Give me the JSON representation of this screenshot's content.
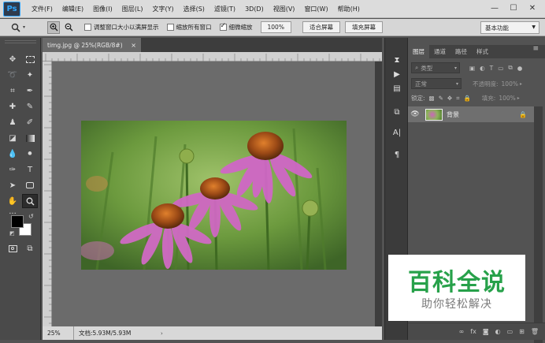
{
  "app": {
    "logo": "Ps"
  },
  "menubar": {
    "items": [
      "文件(F)",
      "编辑(E)",
      "图像(I)",
      "图层(L)",
      "文字(Y)",
      "选择(S)",
      "滤镜(T)",
      "3D(D)",
      "视图(V)",
      "窗口(W)",
      "帮助(H)"
    ],
    "window_controls": [
      "—",
      "☐",
      "✕"
    ]
  },
  "optionsbar": {
    "tool_icon": "magnifier-icon",
    "fit_window_label": "调整窗口大小以满屏显示",
    "zoom_all_label": "缩放所有窗口",
    "scrubby_label": "细微缩放",
    "scrubby_checked": true,
    "zoom_value": "100%",
    "fit_screen_label": "适合屏幕",
    "fill_screen_label": "填充屏幕",
    "workspace": "基本功能"
  },
  "document": {
    "tab_title": "timg.jpg @ 25%(RGB/8#)",
    "tab_close": "×",
    "status_zoom": "25%",
    "status_info": "文档:5.93M/5.93M",
    "status_arrow": "›"
  },
  "toolbar": {
    "tools": [
      "move-tool",
      "marquee-tool",
      "lasso-tool",
      "magic-wand-tool",
      "crop-tool",
      "eyedropper-tool",
      "healing-tool",
      "brush-tool",
      "stamp-tool",
      "history-brush-tool",
      "eraser-tool",
      "gradient-tool",
      "blur-tool",
      "dodge-tool",
      "pen-tool",
      "type-tool",
      "path-select-tool",
      "shape-tool",
      "hand-tool",
      "zoom-tool"
    ],
    "more": "···",
    "foreground_color": "#000000",
    "background_color": "#ffffff"
  },
  "layers_panel": {
    "tabs": [
      "图层",
      "通道",
      "路径",
      "样式"
    ],
    "active_tab": "图层",
    "kind_filter": "类型",
    "blend_mode": "正常",
    "opacity_label": "不透明度:",
    "opacity_value": "100%",
    "lock_label": "锁定:",
    "fill_label": "填充:",
    "fill_value": "100%",
    "layers": [
      {
        "name": "背景",
        "visible": true,
        "locked": true
      }
    ],
    "footer_icons": [
      "link-icon",
      "fx-icon",
      "mask-icon",
      "adjustment-icon",
      "folder-icon",
      "new-layer-icon",
      "trash-icon"
    ],
    "footer_labels": [
      "∞",
      "fx",
      "◙",
      "◐",
      "▭",
      "⊞",
      "🗑"
    ]
  },
  "watermark": {
    "main": "百科全说",
    "sub": "助你轻松解决",
    "color": "#27a14a"
  }
}
